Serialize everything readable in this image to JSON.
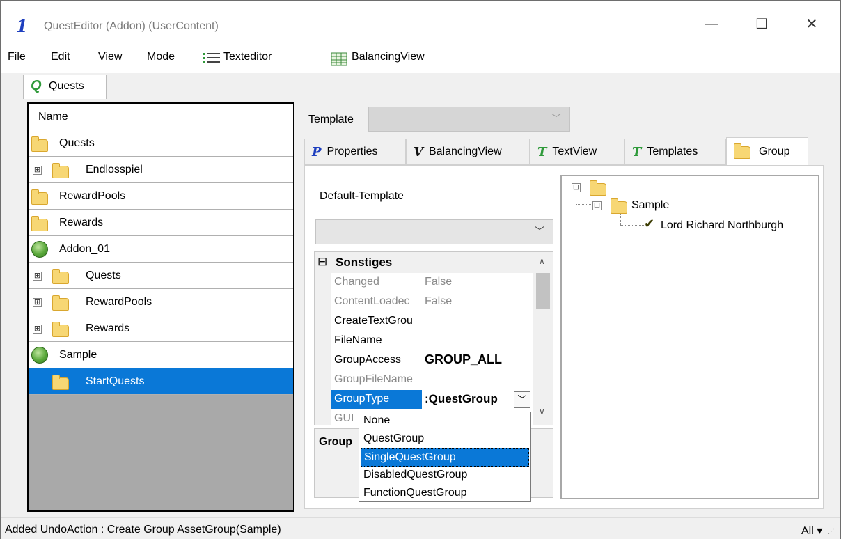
{
  "window": {
    "title": "QuestEditor (Addon) (UserContent)",
    "app_icon": "1",
    "controls": {
      "minimize": "—",
      "maximize": "☐",
      "close": "✕"
    }
  },
  "menu": {
    "file": "File",
    "edit": "Edit",
    "view": "View",
    "mode": "Mode",
    "texteditor": "Texteditor",
    "balancingview": "BalancingView"
  },
  "top_tab": {
    "label": "Quests",
    "icon": "quest-icon"
  },
  "tree": {
    "header": "Name",
    "rows": [
      {
        "label": "Quests",
        "icon": "folder-icon",
        "expander": ""
      },
      {
        "label": "Endlosspiel",
        "icon": "folder-icon",
        "expander": "⊞"
      },
      {
        "label": "RewardPools",
        "icon": "folder-icon",
        "expander": ""
      },
      {
        "label": "Rewards",
        "icon": "folder-icon",
        "expander": ""
      },
      {
        "label": "Addon_01",
        "icon": "globe-icon",
        "expander": ""
      },
      {
        "label": "Quests",
        "icon": "folder-icon",
        "expander": "⊞"
      },
      {
        "label": "RewardPools",
        "icon": "folder-icon",
        "expander": "⊞"
      },
      {
        "label": "Rewards",
        "icon": "folder-icon",
        "expander": "⊞"
      },
      {
        "label": "Sample",
        "icon": "globe-icon",
        "expander": ""
      },
      {
        "label": "StartQuests",
        "icon": "folder-icon",
        "expander": "",
        "selected": true
      }
    ]
  },
  "template": {
    "label": "Template",
    "value": ""
  },
  "tabs": [
    {
      "label": "Properties",
      "glyph": "P"
    },
    {
      "label": "BalancingView",
      "glyph": "V"
    },
    {
      "label": "TextView",
      "glyph": "T"
    },
    {
      "label": "Templates",
      "glyph": "T"
    },
    {
      "label": "Group",
      "glyph": "",
      "active": true
    }
  ],
  "group_page": {
    "default_template_label": "Default-Template",
    "default_template_value": "",
    "property_category": "Sonstiges",
    "properties": [
      {
        "name": "Changed",
        "value": "False",
        "readonly": true
      },
      {
        "name": "ContentLoadec",
        "value": "False",
        "readonly": true
      },
      {
        "name": "CreateTextGrou",
        "value": "",
        "readonly": false
      },
      {
        "name": "FileName",
        "value": "",
        "readonly": false
      },
      {
        "name": "GroupAccess",
        "value": "GROUP_ALL",
        "readonly": false,
        "bold": true
      },
      {
        "name": "GroupFileName",
        "value": "",
        "readonly": true
      },
      {
        "name": "GroupType",
        "value": ":QuestGroup",
        "readonly": false,
        "bold": true,
        "selected": true
      },
      {
        "name": "GUI",
        "value": "",
        "readonly": true
      }
    ],
    "description_title": "Group"
  },
  "group_tree": {
    "root": "",
    "child": "Sample",
    "leaf": "Lord Richard Northburgh"
  },
  "dropdown": {
    "items": [
      "None",
      "QuestGroup",
      "SingleQuestGroup",
      "DisabledQuestGroup",
      "FunctionQuestGroup"
    ],
    "selected_index": 2
  },
  "status": {
    "message": "Added UndoAction : Create Group AssetGroup(Sample)",
    "filter": "All ▾"
  },
  "colors": {
    "selection": "#0a78d7",
    "tree_background": "#a9a9a9",
    "accent_icon": "#1e3fbf"
  }
}
